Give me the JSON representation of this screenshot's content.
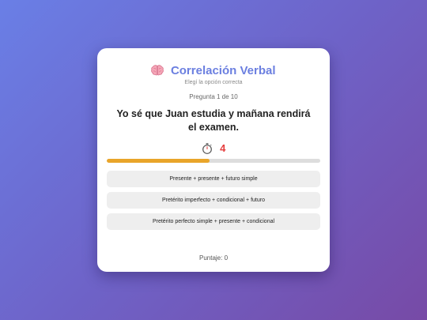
{
  "header": {
    "icon": "brain-icon",
    "title": "Correlación Verbal",
    "subtitle": "Elegí la opción correcta"
  },
  "counter": "Pregunta 1 de 10",
  "question": "Yo sé que Juan estudia y mañana rendirá el examen.",
  "timer": {
    "icon": "stopwatch-icon",
    "value": "4",
    "color": "#e53e3e"
  },
  "progress": {
    "fraction": 0.48,
    "fill_color": "#e9a52a",
    "track_color": "#dddddd"
  },
  "options": [
    "Presente + presente + futuro simple",
    "Pretérito imperfecto + condicional + futuro",
    "Pretérito perfecto simple + presente + condicional"
  ],
  "score": "Puntaje: 0",
  "colors": {
    "accent": "#6b7fe0",
    "background_start": "#6a7fe6",
    "background_end": "#774aa6"
  }
}
